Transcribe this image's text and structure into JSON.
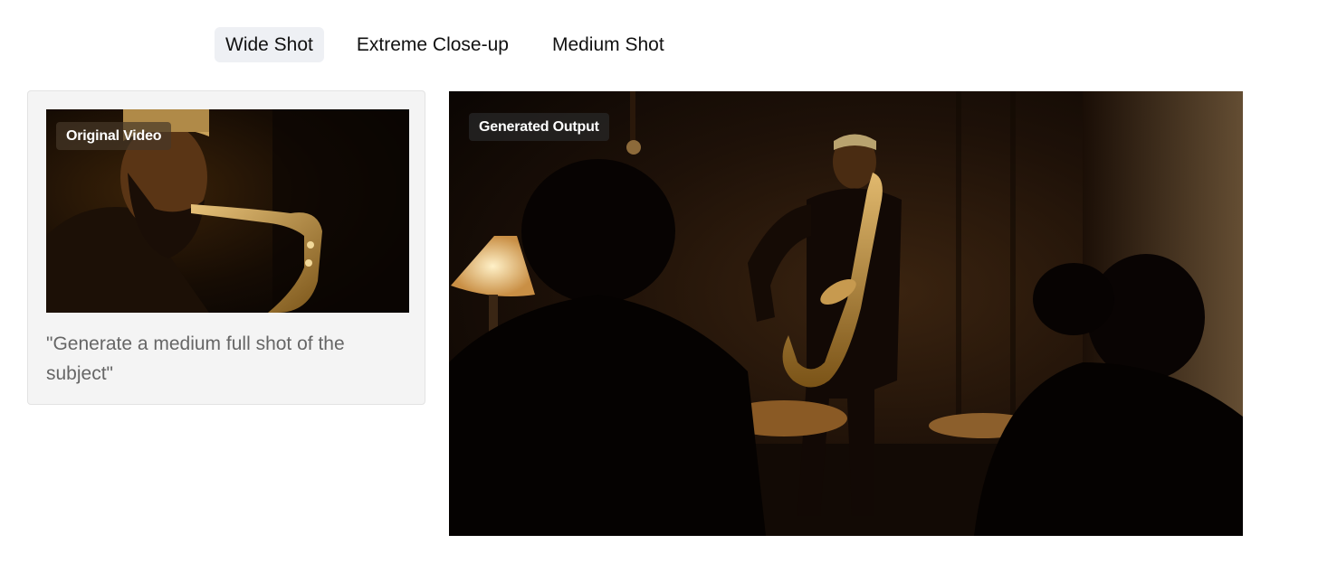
{
  "tabs": [
    {
      "label": "Wide Shot",
      "active": true
    },
    {
      "label": "Extreme Close-up",
      "active": false
    },
    {
      "label": "Medium Shot",
      "active": false
    }
  ],
  "prompt_card": {
    "badge": "Original Video",
    "prompt": "\"Generate a medium full shot of the subject\""
  },
  "output": {
    "badge": "Generated Output"
  },
  "colors": {
    "active_tab_bg": "#eef0f4",
    "card_bg": "#f4f4f4",
    "prompt_text": "#666666",
    "badge_bg": "#282828"
  }
}
